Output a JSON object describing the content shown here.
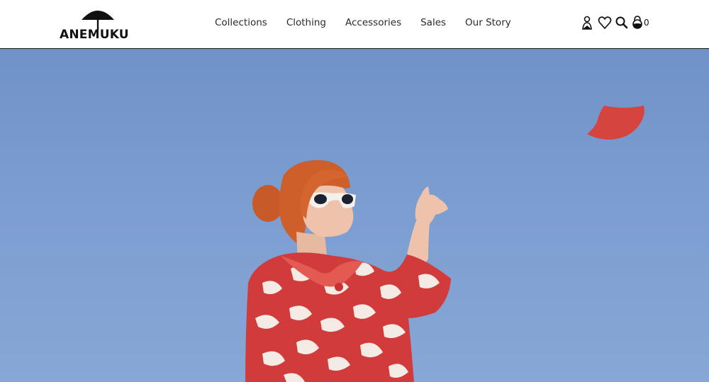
{
  "brand": {
    "name": "ANEMUKU"
  },
  "nav": {
    "items": [
      {
        "label": "Collections"
      },
      {
        "label": "Clothing"
      },
      {
        "label": "Accessories"
      },
      {
        "label": "Sales"
      },
      {
        "label": "Our Story"
      }
    ]
  },
  "header_icons": {
    "account": "user-icon",
    "wishlist": "heart-icon",
    "search": "search-icon",
    "cart": "bag-icon",
    "cart_count": "0"
  },
  "hero": {
    "image_subject": "Red-haired woman in white sunglasses and a red-and-white patterned coat against a blue sky, hand raised toward a red fabric shape",
    "sky_color": "#7a9bd0",
    "accent_color": "#d9443f",
    "coat_colors": [
      "#d13c3c",
      "#f4ece4"
    ]
  }
}
